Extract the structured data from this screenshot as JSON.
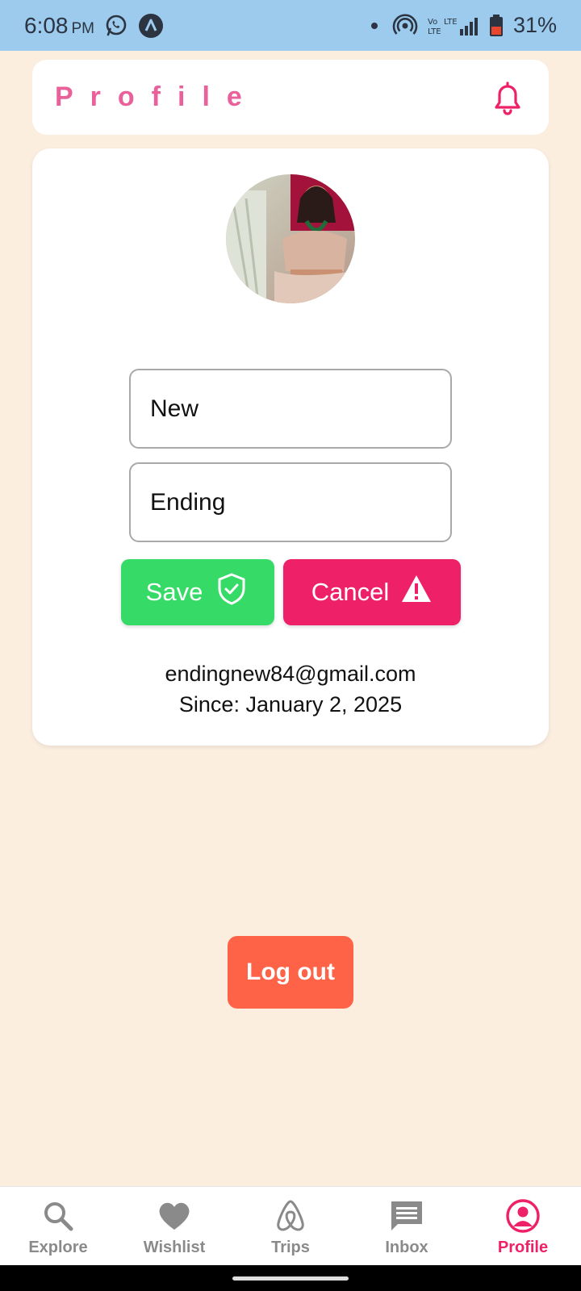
{
  "status_bar": {
    "time": "6:08",
    "period": "PM",
    "battery": "31%"
  },
  "header": {
    "title": "Profile"
  },
  "profile": {
    "first_name": "New",
    "last_name": "Ending",
    "save_label": "Save",
    "cancel_label": "Cancel",
    "email": "endingnew84@gmail.com",
    "since": "Since: January 2, 2025"
  },
  "logout": {
    "label": "Log out"
  },
  "bottom_nav": {
    "items": [
      {
        "label": "Explore",
        "icon": "search-icon"
      },
      {
        "label": "Wishlist",
        "icon": "heart-icon"
      },
      {
        "label": "Trips",
        "icon": "airbnb-logo-icon"
      },
      {
        "label": "Inbox",
        "icon": "message-icon"
      },
      {
        "label": "Profile",
        "icon": "user-circle-icon"
      }
    ],
    "active": "Profile"
  },
  "colors": {
    "background": "#FBEEDF",
    "status_bar": "#9CCBEE",
    "title_pink": "#E9609A",
    "save_green": "#35DB66",
    "cancel_pink": "#EE2168",
    "logout_orange": "#FF6347",
    "nav_active": "#EE2168",
    "nav_inactive": "#8A8A8A"
  }
}
